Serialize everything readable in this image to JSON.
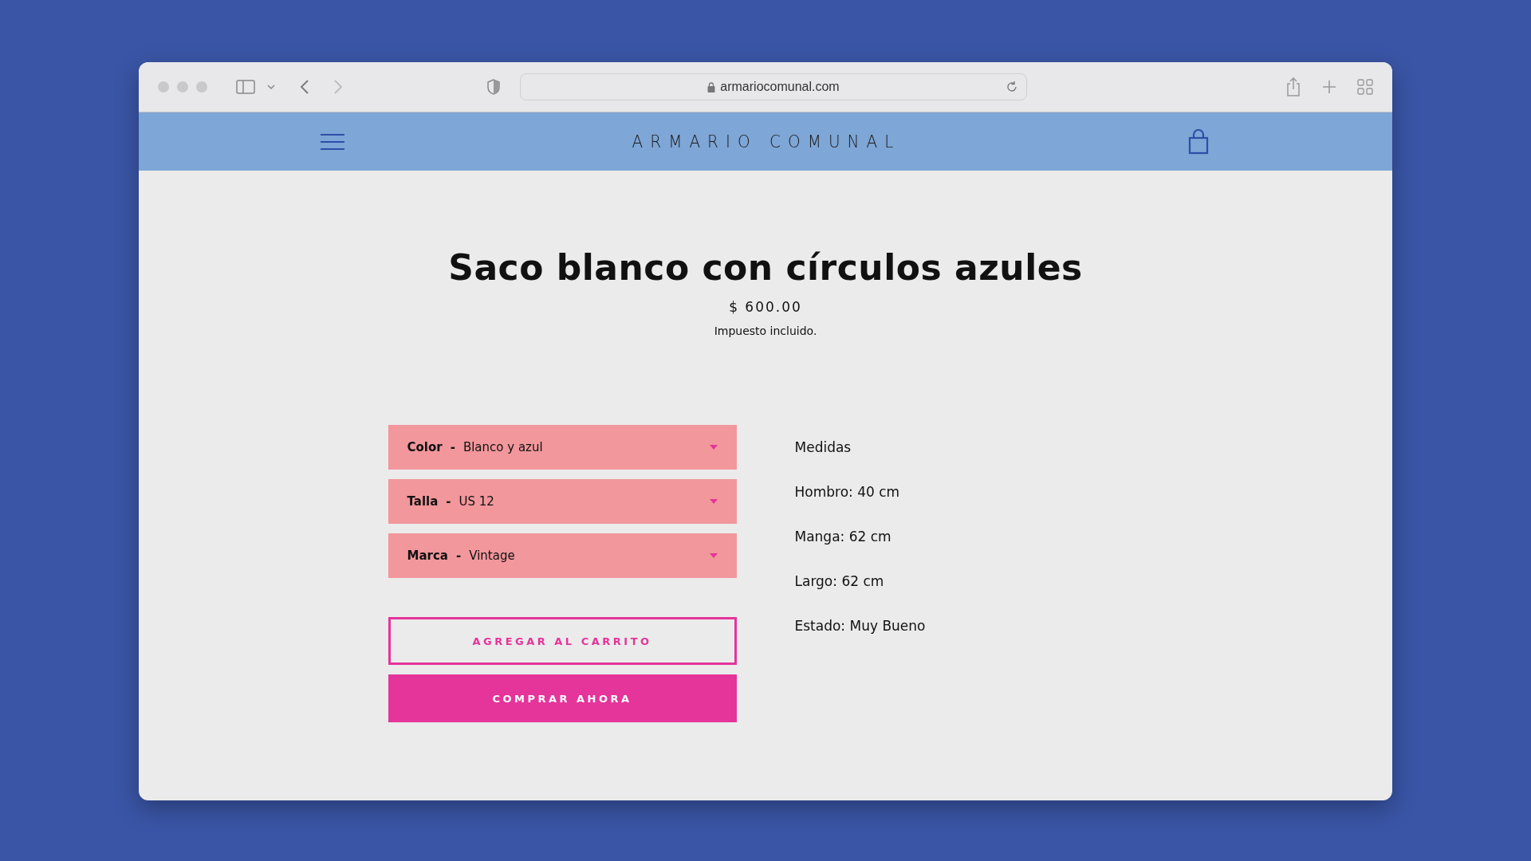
{
  "browser": {
    "url": "armariocomunal.com"
  },
  "header": {
    "logo": "ARMARIO COMUNAL"
  },
  "product": {
    "title": "Saco blanco con círculos azules",
    "price": "$ 600.00",
    "tax_note": "Impuesto incluido."
  },
  "options": [
    {
      "label": "Color",
      "separator": "-",
      "value": "Blanco y azul"
    },
    {
      "label": "Talla",
      "separator": "-",
      "value": "US 12"
    },
    {
      "label": "Marca",
      "separator": "-",
      "value": "Vintage"
    }
  ],
  "buttons": [
    {
      "kind": "outline",
      "label": "AGREGAR AL CARRITO"
    },
    {
      "kind": "filled",
      "label": "COMPRAR AHORA"
    }
  ],
  "details": [
    "Medidas",
    "Hombro: 40 cm",
    "Manga: 62 cm",
    "Largo: 62 cm",
    "Estado: Muy Bueno"
  ]
}
